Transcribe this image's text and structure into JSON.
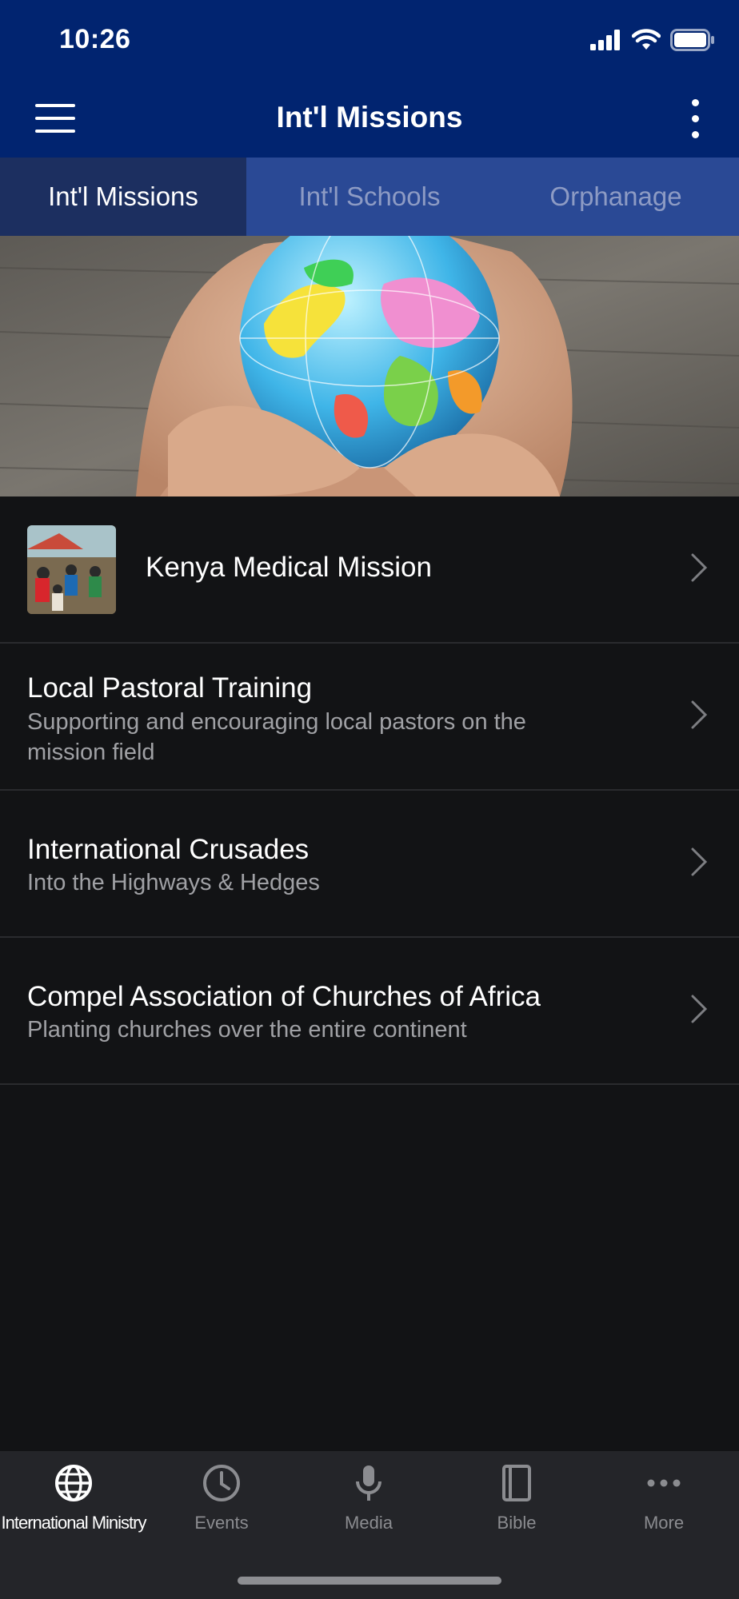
{
  "status_bar": {
    "time": "10:26"
  },
  "nav": {
    "title": "Int'l Missions"
  },
  "tabs": [
    {
      "label": "Int'l Missions",
      "active": true
    },
    {
      "label": "Int'l Schools",
      "active": false
    },
    {
      "label": "Orphanage",
      "active": false
    }
  ],
  "list": [
    {
      "title": "Kenya Medical Mission",
      "subtitle": ""
    },
    {
      "title": "Local Pastoral Training",
      "subtitle": "Supporting and encouraging local pastors on the mission field"
    },
    {
      "title": "International Crusades",
      "subtitle": "Into the Highways & Hedges"
    },
    {
      "title": "Compel Association of Churches of Africa",
      "subtitle": "Planting churches over the entire continent"
    }
  ],
  "tabbar": [
    {
      "label": "International Ministry",
      "icon": "globe-icon",
      "active": true
    },
    {
      "label": "Events",
      "icon": "clock-icon",
      "active": false
    },
    {
      "label": "Media",
      "icon": "microphone-icon",
      "active": false
    },
    {
      "label": "Bible",
      "icon": "book-icon",
      "active": false
    },
    {
      "label": "More",
      "icon": "ellipsis-icon",
      "active": false
    }
  ],
  "colors": {
    "header": "#012470",
    "tabs_bg": "#2a4995",
    "tab_active": "#1c2f60",
    "background": "#121315",
    "tabbar": "#242529"
  }
}
